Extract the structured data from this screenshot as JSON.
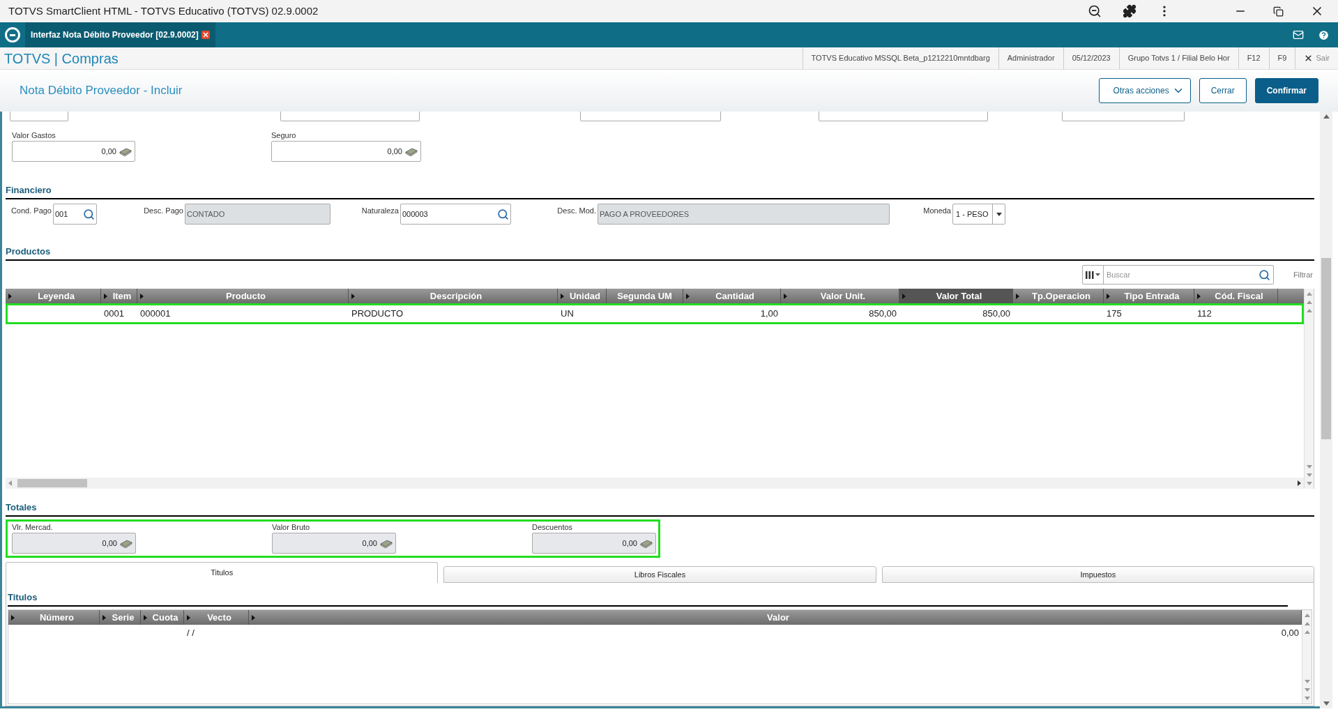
{
  "window": {
    "title": "TOTVS SmartClient HTML - TOTVS Educativo (TOTVS) 02.9.0002"
  },
  "app_tab": {
    "label": "Interfaz Nota Débito Proveedor [02.9.0002]"
  },
  "header": {
    "brand": "TOTVS | Compras",
    "info": [
      "TOTVS Educativo MSSQL Beta_p1212210mntdbarg",
      "Administrador",
      "05/12/2023",
      "Grupo Totvs 1 / Filial Belo Hor",
      "F12",
      "F9"
    ],
    "exit": "Sair"
  },
  "page": {
    "title": "Nota Débito Proveedor - Incluir",
    "buttons": [
      {
        "label": "Otras acciones",
        "kind": "menu"
      },
      {
        "label": "Cerrar",
        "kind": "secondary"
      },
      {
        "label": "Confirmar",
        "kind": "primary"
      }
    ]
  },
  "expenses": [
    {
      "label": "Valor Gastos",
      "value": "0,00"
    },
    {
      "label": "Seguro",
      "value": "0,00"
    }
  ],
  "financiero": {
    "title": "Financiero",
    "fields": [
      {
        "label": "Cond. Pago",
        "value": "001",
        "kind": "lookup"
      },
      {
        "label": "Desc. Pago",
        "value": "CONTADO",
        "kind": "readonly"
      },
      {
        "label": "Naturaleza",
        "value": "000003",
        "kind": "lookup"
      },
      {
        "label": "Desc. Mod.",
        "value": "PAGO A PROVEEDORES",
        "kind": "readonly"
      },
      {
        "label": "Moneda",
        "value": "1 - PESO",
        "kind": "select"
      }
    ]
  },
  "productos": {
    "title": "Productos",
    "search": {
      "placeholder": "Buscar"
    },
    "filter": "Filtrar",
    "columns": [
      {
        "label": "Leyenda",
        "arrow": true,
        "highlighted": false
      },
      {
        "label": "Item",
        "arrow": true,
        "highlighted": false
      },
      {
        "label": "Producto",
        "arrow": true,
        "highlighted": false
      },
      {
        "label": "Descripción",
        "arrow": true,
        "highlighted": false
      },
      {
        "label": "Unidad",
        "arrow": true,
        "highlighted": false
      },
      {
        "label": "Segunda UM",
        "arrow": false,
        "highlighted": false
      },
      {
        "label": "Cantidad",
        "arrow": true,
        "highlighted": false
      },
      {
        "label": "Valor Unit.",
        "arrow": true,
        "highlighted": false
      },
      {
        "label": "Valor Total",
        "arrow": true,
        "highlighted": true
      },
      {
        "label": "Tp.Operacion",
        "arrow": true,
        "highlighted": false
      },
      {
        "label": "Tipo Entrada",
        "arrow": true,
        "highlighted": false
      },
      {
        "label": "Cód. Fiscal",
        "arrow": true,
        "highlighted": false
      }
    ],
    "rows": [
      {
        "cells": [
          null,
          "0001",
          "000001",
          "PRODUCTO",
          "UN",
          null,
          "1,00",
          "850,00",
          "850,00",
          null,
          "175",
          "112"
        ]
      }
    ]
  },
  "totales": {
    "title": "Totales",
    "fields": [
      {
        "label": "Vlr. Mercad.",
        "value": "0,00"
      },
      {
        "label": "Valor Bruto",
        "value": "0,00"
      },
      {
        "label": "Descuentos",
        "value": "0,00"
      }
    ]
  },
  "tabs": [
    {
      "label": "Titulos",
      "selected": true
    },
    {
      "label": "Libros Fiscales",
      "selected": false
    },
    {
      "label": "Impuestos",
      "selected": false
    }
  ],
  "titulos": {
    "title": "Titulos",
    "columns": [
      {
        "label": "Número",
        "arrow": true
      },
      {
        "label": "Serie",
        "arrow": true
      },
      {
        "label": "Cuota",
        "arrow": true
      },
      {
        "label": "Vecto",
        "arrow": true
      },
      {
        "label": "Valor",
        "arrow": true
      }
    ],
    "rows": [
      {
        "cells": [
          null,
          null,
          null,
          "/ /",
          "0,00"
        ]
      }
    ]
  }
}
